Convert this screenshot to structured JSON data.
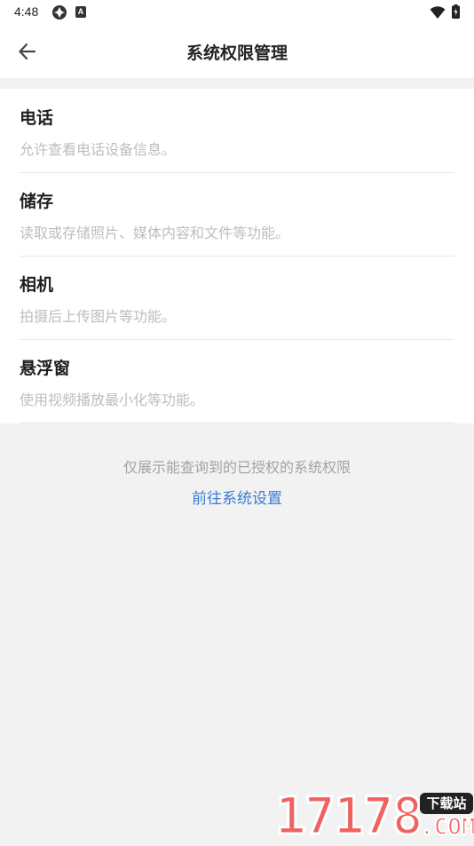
{
  "status_bar": {
    "time": "4:48",
    "notification_badge": "A"
  },
  "header": {
    "title": "系统权限管理"
  },
  "permissions": [
    {
      "name": "电话",
      "description": "允许查看电话设备信息。"
    },
    {
      "name": "储存",
      "description": "读取或存储照片、媒体内容和文件等功能。"
    },
    {
      "name": "相机",
      "description": "拍摄后上传图片等功能。"
    },
    {
      "name": "悬浮窗",
      "description": "使用视频播放最小化等功能。"
    }
  ],
  "footer": {
    "note": "仅展示能查询到的已授权的系统权限",
    "settings_link": "前往系统设置"
  },
  "watermark": {
    "number": "17178",
    "tag": "下载站",
    "domain": ".COM"
  },
  "colors": {
    "link": "#3a7bd5",
    "background": "#f2f2f2",
    "watermark": "#f06262"
  }
}
